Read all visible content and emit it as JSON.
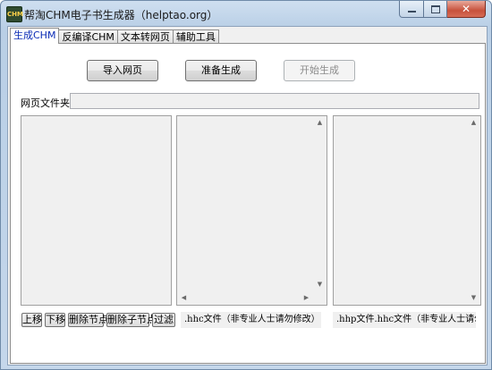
{
  "window": {
    "title": "帮淘CHM电子书生成器（helptao.org）",
    "icon_text": "CHM"
  },
  "tabs": [
    {
      "label": "生成CHM",
      "active": true
    },
    {
      "label": "反编译CHM",
      "active": false
    },
    {
      "label": "文本转网页",
      "active": false
    },
    {
      "label": "辅助工具",
      "active": false
    }
  ],
  "actions": {
    "import_label": "导入网页",
    "prepare_label": "准备生成",
    "start_label": "开始生成"
  },
  "folder": {
    "label": "网页文件夹:",
    "value": ""
  },
  "tree_buttons": {
    "up": "上移",
    "down": "下移",
    "delete_node": "删除节点",
    "delete_child": "删除子节点",
    "filter": "过滤"
  },
  "status": {
    "hhc": ".hhc文件（非专业人士请勿修改）",
    "hhp": ".hhp文件.hhc文件（非专业人士请勿修"
  }
}
